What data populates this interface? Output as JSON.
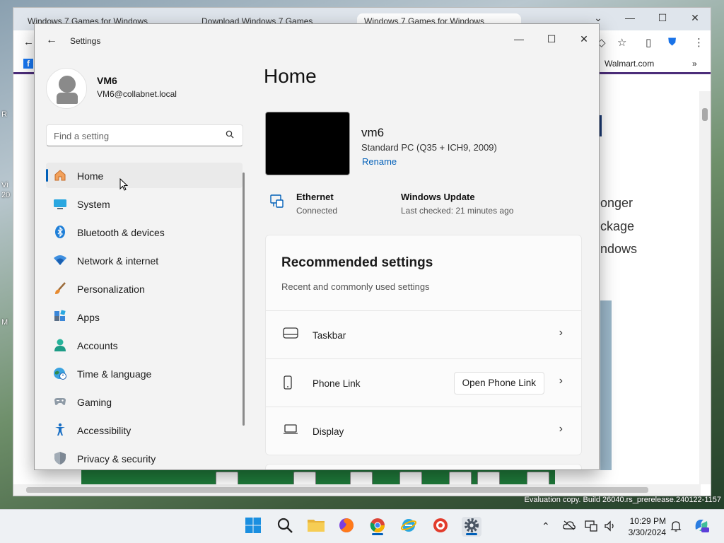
{
  "desktop": {
    "labels": [
      "R",
      "Vi",
      "20",
      "M"
    ]
  },
  "browser": {
    "tabs": [
      "Windows 7 Games for Windows",
      "Download Windows 7 Games",
      "Windows 7 Games for Windows"
    ],
    "bookmark_walmart": "Walmart.com",
    "page_fragments": [
      "onger",
      "ckage",
      "ndows"
    ]
  },
  "settings": {
    "window_title": "Settings",
    "user": {
      "name": "VM6",
      "email": "VM6@collabnet.local"
    },
    "search": {
      "placeholder": "Find a setting"
    },
    "nav": [
      {
        "label": "Home",
        "icon": "home-icon",
        "active": true
      },
      {
        "label": "System",
        "icon": "system-icon"
      },
      {
        "label": "Bluetooth & devices",
        "icon": "bluetooth-icon"
      },
      {
        "label": "Network & internet",
        "icon": "network-icon"
      },
      {
        "label": "Personalization",
        "icon": "brush-icon"
      },
      {
        "label": "Apps",
        "icon": "apps-icon"
      },
      {
        "label": "Accounts",
        "icon": "accounts-icon"
      },
      {
        "label": "Time & language",
        "icon": "globe-clock-icon"
      },
      {
        "label": "Gaming",
        "icon": "gamepad-icon"
      },
      {
        "label": "Accessibility",
        "icon": "accessibility-icon"
      },
      {
        "label": "Privacy & security",
        "icon": "shield-icon"
      }
    ],
    "main": {
      "title": "Home",
      "device": {
        "name": "vm6",
        "model": "Standard PC (Q35 + ICH9, 2009)",
        "rename": "Rename"
      },
      "ethernet": {
        "title": "Ethernet",
        "status": "Connected"
      },
      "windows_update": {
        "title": "Windows Update",
        "status": "Last checked: 21 minutes ago"
      },
      "recommended": {
        "title": "Recommended settings",
        "subtitle": "Recent and commonly used settings",
        "rows": [
          {
            "label": "Taskbar",
            "icon": "taskbar-icon"
          },
          {
            "label": "Phone Link",
            "icon": "phone-icon",
            "button": "Open Phone Link"
          },
          {
            "label": "Display",
            "icon": "display-icon"
          }
        ]
      }
    }
  },
  "watermark": "Evaluation copy. Build 26040.rs_prerelease.240122-1157",
  "taskbar": {
    "time": "10:29 PM",
    "date": "3/30/2024"
  },
  "colors": {
    "accent": "#005fb8",
    "window_bg": "#f3f3f3"
  }
}
